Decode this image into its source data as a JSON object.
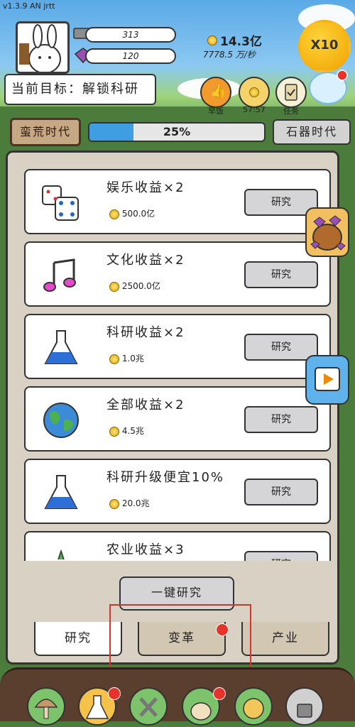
{
  "version": "v1.3.9 AN jrtt",
  "header": {
    "stone_count": "313",
    "gem_count": "120",
    "gold_total": "14.3亿",
    "gold_rate": "7778.5 万/秒",
    "multiplier_label": "X10"
  },
  "goal": {
    "text": "当前目标：解锁科研"
  },
  "quick": {
    "items": [
      {
        "label": "早饭",
        "color": "#f39a2c"
      },
      {
        "label": "57:57",
        "color": "#f4d36a"
      },
      {
        "label": "任务",
        "color": "#f6f0d6"
      }
    ]
  },
  "era": {
    "current": "蛮荒时代",
    "progress_text": "25%",
    "progress_value": 0.25,
    "next": "石器时代"
  },
  "research": {
    "items": [
      {
        "title": "娱乐收益×2",
        "cost": "500.0亿",
        "button": "研究",
        "icon": "dice-icon"
      },
      {
        "title": "文化收益×2",
        "cost": "2500.0亿",
        "button": "研究",
        "icon": "music-note-icon"
      },
      {
        "title": "科研收益×2",
        "cost": "1.0兆",
        "button": "研究",
        "icon": "flask-icon"
      },
      {
        "title": "全部收益×2",
        "cost": "4.5兆",
        "button": "研究",
        "icon": "globe-icon"
      },
      {
        "title": "科研升级便宜10%",
        "cost": "20.0兆",
        "button": "研究",
        "icon": "flask-icon"
      },
      {
        "title": "农业收益×3",
        "cost": "",
        "button": "研究",
        "icon": "carrot-icon"
      }
    ],
    "one_key": "一键研究"
  },
  "tabs": [
    {
      "label": "研究",
      "active": true
    },
    {
      "label": "变革",
      "active": false
    },
    {
      "label": "产业",
      "active": false
    }
  ],
  "colors": {
    "accent_blue": "#3f9ee2",
    "badge_red": "#e8332b",
    "highlight_red": "#d6332c"
  }
}
